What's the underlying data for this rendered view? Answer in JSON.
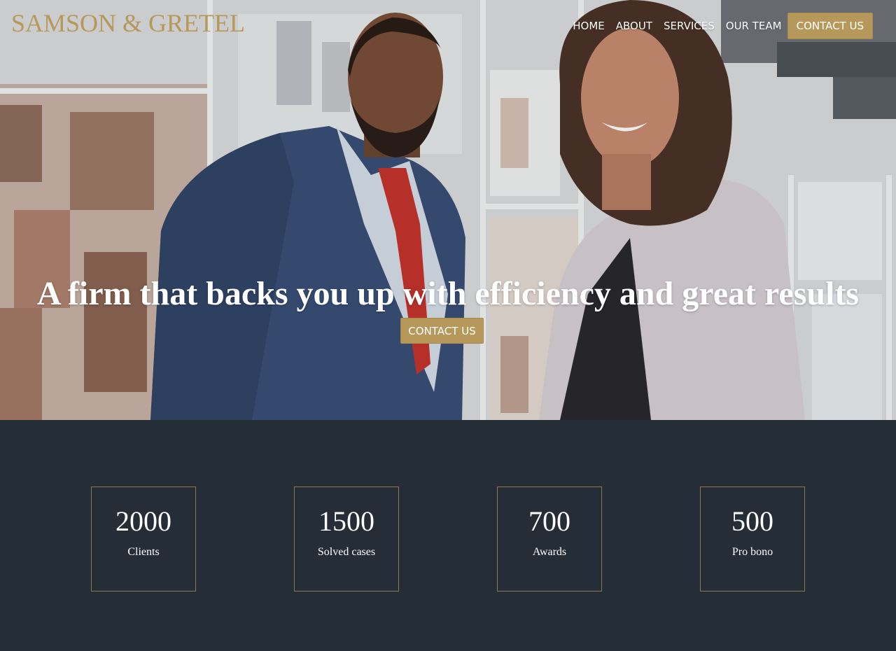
{
  "brand": {
    "name": "SAMSON & GRETEL"
  },
  "nav": {
    "items": [
      "HOME",
      "ABOUT",
      "SERVICES",
      "OUR TEAM"
    ],
    "cta_label": "CONTACT US"
  },
  "hero": {
    "headline": "A firm that backs you up with efficiency and great results",
    "cta_label": "CONTACT US"
  },
  "stats": [
    {
      "value": "2000",
      "label": "Clients"
    },
    {
      "value": "1500",
      "label": "Solved cases"
    },
    {
      "value": "700",
      "label": "Awards"
    },
    {
      "value": "500",
      "label": "Pro bono"
    }
  ],
  "colors": {
    "accent_gold": "#b6985a",
    "dark_background": "#252d36",
    "text_light": "#ffffff"
  }
}
